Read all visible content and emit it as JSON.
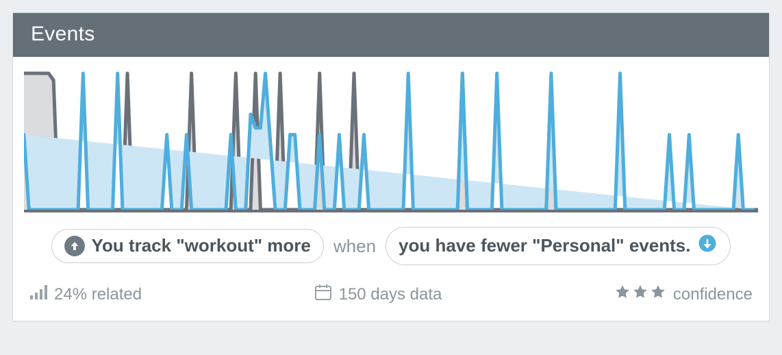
{
  "header": {
    "title": "Events"
  },
  "insight": {
    "pill_a": {
      "direction": "up",
      "text": "You track \"workout\" more"
    },
    "connector": "when",
    "pill_b": {
      "direction": "down",
      "text": "you have fewer \"Personal\" events."
    }
  },
  "footer": {
    "related": "24% related",
    "duration": "150 days data",
    "confidence_label": "confidence",
    "confidence_stars": 3
  },
  "colors": {
    "series_a_stroke": "#6a7178",
    "series_a_fill": "#d3d6d9",
    "series_b_stroke": "#4faedd",
    "series_b_fill": "#cde6f5",
    "accent": "#4faedd"
  },
  "chart_data": {
    "type": "area",
    "title": "",
    "xlabel": "",
    "ylabel": "",
    "x_range": [
      0,
      150
    ],
    "ylim": [
      0,
      1
    ],
    "series": [
      {
        "name": "workout",
        "color": "#6a7178",
        "values": [
          1,
          1,
          1,
          1,
          1,
          1,
          0.95,
          0,
          0,
          0,
          0,
          0,
          0,
          0,
          0,
          0,
          0,
          0,
          0,
          0,
          0,
          1,
          0,
          0,
          0,
          0,
          0,
          0,
          0,
          0,
          0,
          0,
          0,
          0,
          1,
          0,
          0,
          0,
          0,
          0,
          0,
          0,
          0,
          1,
          0,
          0,
          0,
          1,
          0,
          0,
          0,
          0,
          1,
          0,
          0,
          0,
          0,
          0,
          0,
          0,
          1,
          0,
          0,
          0,
          0,
          0,
          0,
          1,
          0,
          0,
          0,
          0,
          0,
          0,
          0,
          0,
          0,
          0,
          0,
          0,
          0,
          0,
          0,
          0,
          0,
          0,
          0,
          0,
          0,
          1,
          0,
          0,
          0,
          0,
          0,
          0,
          0,
          0,
          0,
          0,
          0,
          0,
          0,
          0,
          0,
          0,
          0,
          0.95,
          0,
          0,
          0,
          0,
          0,
          0,
          0,
          0,
          0,
          0,
          0,
          0,
          0,
          0,
          0,
          0,
          0,
          0,
          0,
          0,
          0,
          0,
          0,
          0,
          0,
          0,
          0,
          0,
          0,
          0,
          0,
          0,
          0,
          0,
          0,
          0,
          0,
          0,
          0,
          0,
          0,
          0
        ]
      },
      {
        "name": "Personal events",
        "color": "#4faedd",
        "values": [
          0.55,
          0,
          0,
          0,
          0,
          0,
          0,
          0,
          0,
          0,
          0,
          0,
          1,
          0,
          0,
          0,
          0,
          0,
          0,
          1,
          0,
          0,
          0,
          0,
          0,
          0,
          0,
          0,
          0,
          0.55,
          0,
          0,
          0,
          0.55,
          0,
          0,
          0,
          0,
          0,
          0,
          0,
          0,
          0.55,
          0,
          0,
          0,
          0.7,
          0.6,
          0.6,
          1,
          0.5,
          0,
          0,
          0,
          0.55,
          0.55,
          0,
          0,
          0,
          0,
          0.55,
          0,
          0,
          0,
          0.55,
          0,
          0,
          0,
          0,
          0.55,
          0,
          0,
          0,
          0,
          0,
          0,
          0,
          0,
          1,
          0,
          0,
          0,
          0,
          0,
          0,
          0,
          0,
          0,
          0,
          1,
          0,
          0,
          0,
          0,
          0,
          0,
          1,
          0,
          0,
          0,
          0,
          0,
          0,
          0,
          0,
          0,
          0,
          1,
          0,
          0,
          0,
          0,
          0,
          0,
          0,
          0,
          0,
          0,
          0,
          0,
          0,
          1,
          0,
          0,
          0,
          0,
          0,
          0,
          0,
          0,
          0,
          0.55,
          0,
          0,
          0,
          0.55,
          0,
          0,
          0,
          0,
          0,
          0,
          0,
          0,
          0,
          0.55,
          0,
          0,
          0
        ]
      }
    ]
  }
}
